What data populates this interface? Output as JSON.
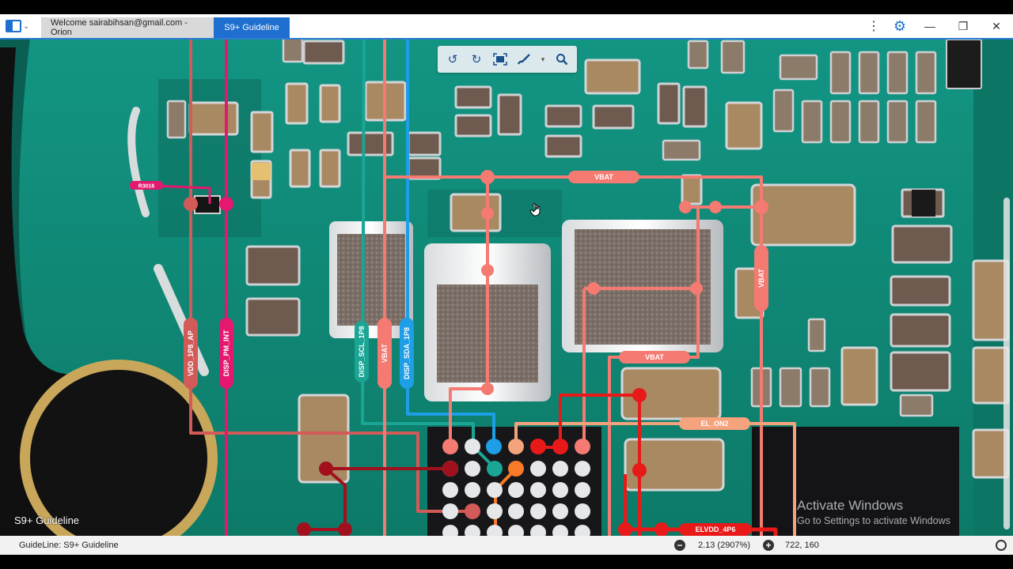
{
  "window": {
    "tabs": [
      {
        "label": "Welcome sairabihsan@gmail.com - Orion",
        "active": false
      },
      {
        "label": "S9+ Guideline",
        "active": true
      }
    ],
    "controls": {
      "menu": "⋮",
      "minimize": "—",
      "maximize": "❐",
      "close": "✕"
    }
  },
  "toolbar": {
    "icons": [
      "rotate-ccw-icon",
      "rotate-cw-icon",
      "fit-screen-icon",
      "brush-icon",
      "search-icon"
    ]
  },
  "canvas": {
    "overlay_label": "S9+ Guideline",
    "net_labels": {
      "r3016": "R3016",
      "vdd_1p8_ap": "VDD_1P8_AP",
      "disp_pm_int": "DISP_PM_INT",
      "disp_scl_1p8": "DISP_SCL_1P8",
      "vbat_v": "VBAT",
      "disp_sda_1p8": "DISP_SDA_1P8",
      "vbat_top": "VBAT",
      "vbat_right": "VBAT",
      "vbat_mid": "VBAT",
      "el_on2": "EL_ON2",
      "elvdd_4p6": "ELVDD_4P6"
    },
    "trace_colors": {
      "vbat": "#f47a72",
      "pink": "#e4186e",
      "teal": "#1aa595",
      "blue": "#1d9ee6",
      "dark_red": "#a1101c",
      "red": "#e81919",
      "orange": "#f97a28",
      "salmon": "#f5a37c"
    }
  },
  "activation": {
    "title": "Activate Windows",
    "subtitle": "Go to Settings to activate Windows"
  },
  "status": {
    "guideline": "GuideLine: S9+ Guideline",
    "zoom": "2.13 (2907%)",
    "coords": "722, 160"
  }
}
